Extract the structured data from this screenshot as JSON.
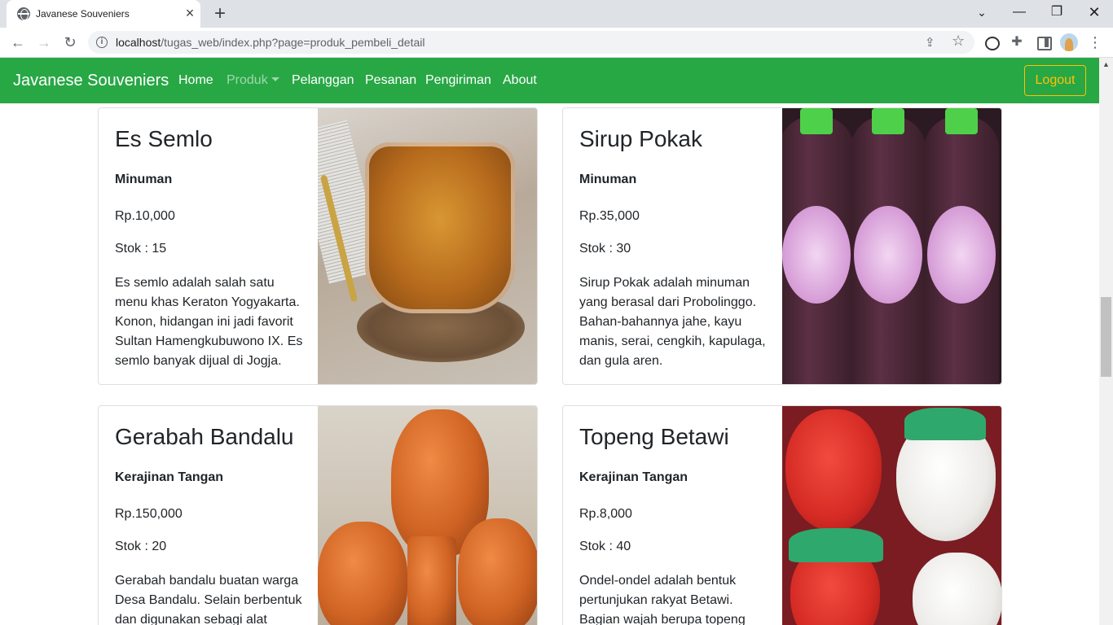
{
  "browser": {
    "tab_title": "Javanese Souveniers",
    "url_host": "localhost",
    "url_path": "/tugas_web/index.php?page=produk_pembeli_detail"
  },
  "navbar": {
    "brand": "Javanese Souveniers",
    "links": [
      "Home",
      "Produk",
      "Pelanggan",
      "Pesanan",
      "Pengiriman",
      "About"
    ],
    "active_link": "Produk",
    "logout": "Logout",
    "colors": {
      "background": "#28a745",
      "logout": "#ffc107"
    }
  },
  "products": [
    {
      "name": "Es Semlo",
      "category": "Minuman",
      "price": "Rp.10,000",
      "stock": "Stok : 15",
      "description": "Es semlo adalah salah satu menu khas Keraton Yogyakarta. Konon, hidangan ini jadi favorit Sultan Hamengkubuwono IX. Es semlo banyak dijual di Jogja."
    },
    {
      "name": "Sirup Pokak",
      "category": "Minuman",
      "price": "Rp.35,000",
      "stock": "Stok : 30",
      "description": "Sirup Pokak adalah minuman yang berasal dari Probolinggo. Bahan-bahannya jahe, kayu manis, serai, cengkih, kapulaga, dan gula aren."
    },
    {
      "name": "Gerabah Bandalu",
      "category": "Kerajinan Tangan",
      "price": "Rp.150,000",
      "stock": "Stok : 20",
      "description": "Gerabah bandalu buatan warga Desa Bandalu. Selain berbentuk dan digunakan sebagi alat"
    },
    {
      "name": "Topeng Betawi",
      "category": "Kerajinan Tangan",
      "price": "Rp.8,000",
      "stock": "Stok : 40",
      "description": "Ondel-ondel adalah bentuk pertunjukan rakyat Betawi. Bagian wajah berupa topeng"
    }
  ]
}
